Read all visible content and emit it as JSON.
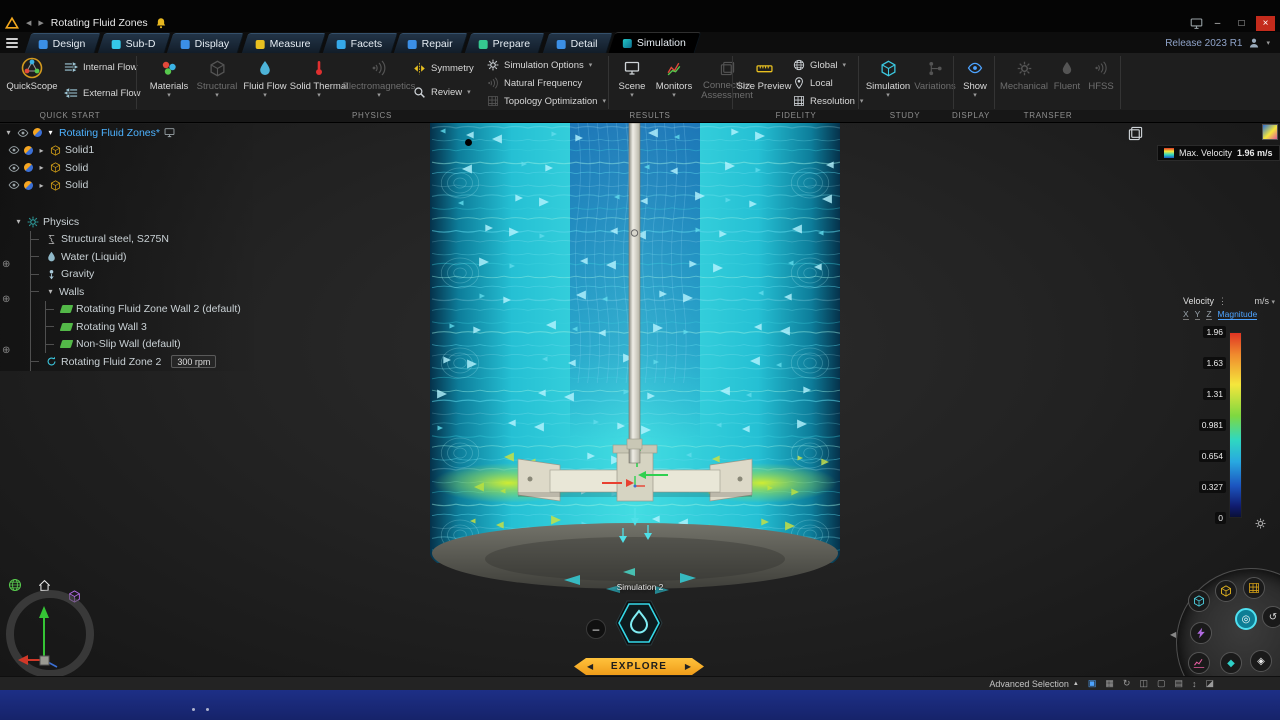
{
  "titlebar": {
    "title": "Rotating Fluid Zones",
    "release": "Release 2023 R1"
  },
  "tabs": [
    {
      "label": "Design"
    },
    {
      "label": "Sub-D"
    },
    {
      "label": "Display"
    },
    {
      "label": "Measure"
    },
    {
      "label": "Facets"
    },
    {
      "label": "Repair"
    },
    {
      "label": "Prepare"
    },
    {
      "label": "Detail"
    },
    {
      "label": "Simulation"
    }
  ],
  "ribbon": {
    "quickscope": "QuickScope",
    "internal_flow": "Internal Flow",
    "external_flow": "External Flow",
    "materials": "Materials",
    "structural": "Structural",
    "fluid_flow": "Fluid Flow",
    "solid_thermal": "Solid Thermal",
    "electromagnetics": "Electromagnetics",
    "symmetry": "Symmetry",
    "review": "Review",
    "simulation_options": "Simulation Options",
    "natural_frequency": "Natural Frequency",
    "topology_optimization": "Topology Optimization",
    "scene": "Scene",
    "monitors": "Monitors",
    "connection_assessment": "Connection Assessment",
    "size_preview": "Size Preview",
    "global": "Global",
    "local": "Local",
    "resolution": "Resolution",
    "simulation": "Simulation",
    "variations": "Variations",
    "show": "Show",
    "mechanical": "Mechanical",
    "fluent": "Fluent",
    "hfss": "HFSS",
    "sections": {
      "quick_start": "Quick Start",
      "physics": "Physics",
      "results": "Results",
      "fidelity": "Fidelity",
      "study": "Study",
      "display": "Display",
      "transfer": "Transfer"
    }
  },
  "tree": {
    "root": "Rotating Fluid Zones*",
    "solid1": "Solid1",
    "solid2": "Solid",
    "solid3": "Solid",
    "physics": "Physics",
    "material": "Structural steel, S275N",
    "fluid": "Water (Liquid)",
    "gravity": "Gravity",
    "walls": "Walls",
    "wall1": "Rotating Fluid Zone Wall 2 (default)",
    "wall2": "Rotating Wall 3",
    "wall3": "Non-Slip Wall (default)",
    "zone": "Rotating Fluid Zone 2",
    "zone_speed": "300 rpm"
  },
  "viewport": {
    "sim_label": "Simulation 2",
    "max_velocity_label": "Max. Velocity",
    "max_velocity_value": "1.96 m/s",
    "explore": "Explore"
  },
  "legend": {
    "title": "Velocity",
    "unit": "m/s",
    "x": "X",
    "y": "Y",
    "z": "Z",
    "component": "Magnitude",
    "ticks": [
      "1.96",
      "1.63",
      "1.31",
      "0.981",
      "0.654",
      "0.327",
      "0"
    ]
  },
  "statusbar": {
    "advanced_selection": "Advanced Selection"
  }
}
